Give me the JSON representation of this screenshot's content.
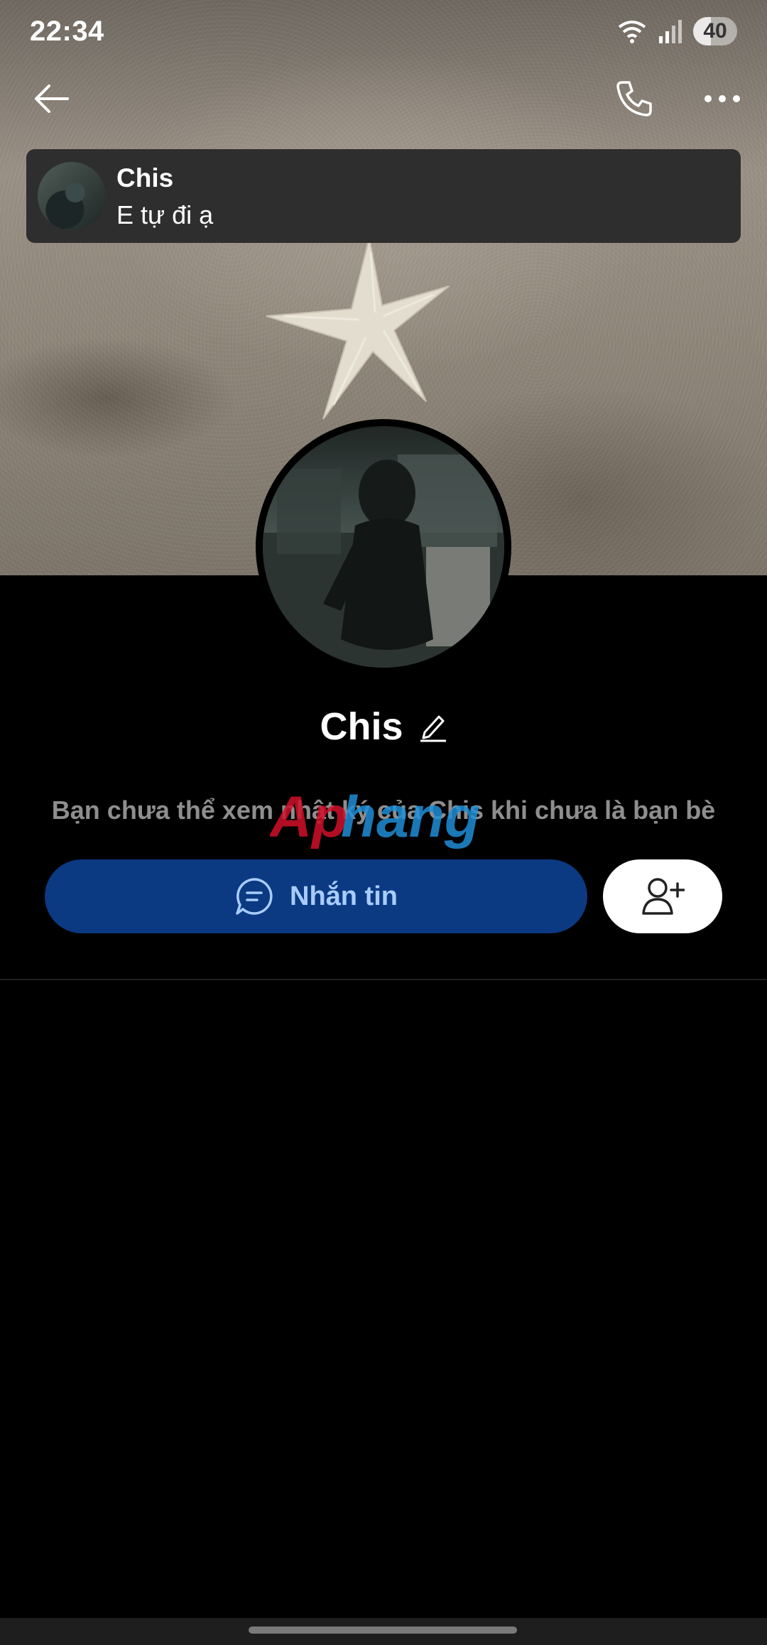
{
  "status_bar": {
    "time": "22:34",
    "battery": "40",
    "icons": [
      "wifi-icon",
      "signal-icon",
      "battery-icon"
    ]
  },
  "header": {
    "back_icon": "arrow-left-icon",
    "call_icon": "phone-icon",
    "more_icon": "more-horizontal-icon"
  },
  "pinned_message": {
    "name": "Chis",
    "message": "E tự đi ạ"
  },
  "profile": {
    "name": "Chis",
    "edit_icon": "pencil-icon",
    "notice": "Bạn chưa thể xem nhật ký của Chis khi chưa là bạn bè"
  },
  "actions": {
    "message_label": "Nhắn tin",
    "message_icon": "chat-bubble-icon",
    "add_friend_icon": "add-user-icon"
  },
  "watermark": {
    "text": "Aphang"
  },
  "colors": {
    "message_button_bg": "#0b3a83",
    "message_button_text": "#a9ccff",
    "notice_text": "#8e8e8e",
    "background": "#000000"
  }
}
